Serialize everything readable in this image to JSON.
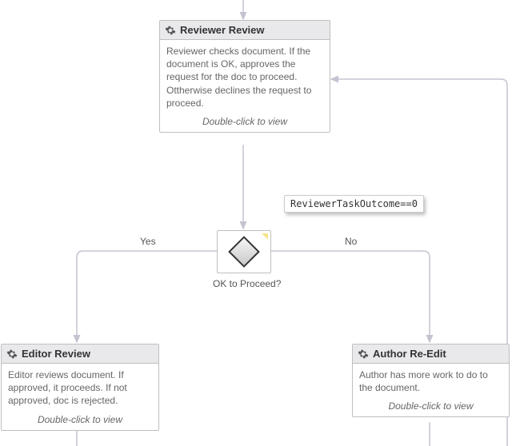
{
  "tasks": {
    "reviewer": {
      "title": "Reviewer Review",
      "body": "Reviewer checks document. If the document is OK, approves the request for the doc to proceed. Ottherwise declines the request to proceed.",
      "hint": "Double-click to view"
    },
    "editor": {
      "title": "Editor Review",
      "body": "Editor reviews document. If approved, it proceeds. If not approved, doc is rejected.",
      "hint": "Double-click to view"
    },
    "author": {
      "title": "Author Re-Edit",
      "body": "Author has more work to do to the document.",
      "hint": "Double-click to view"
    }
  },
  "decision": {
    "question": "OK to Proceed?",
    "yes": "Yes",
    "no": "No"
  },
  "callout": "ReviewerTaskOutcome==0"
}
